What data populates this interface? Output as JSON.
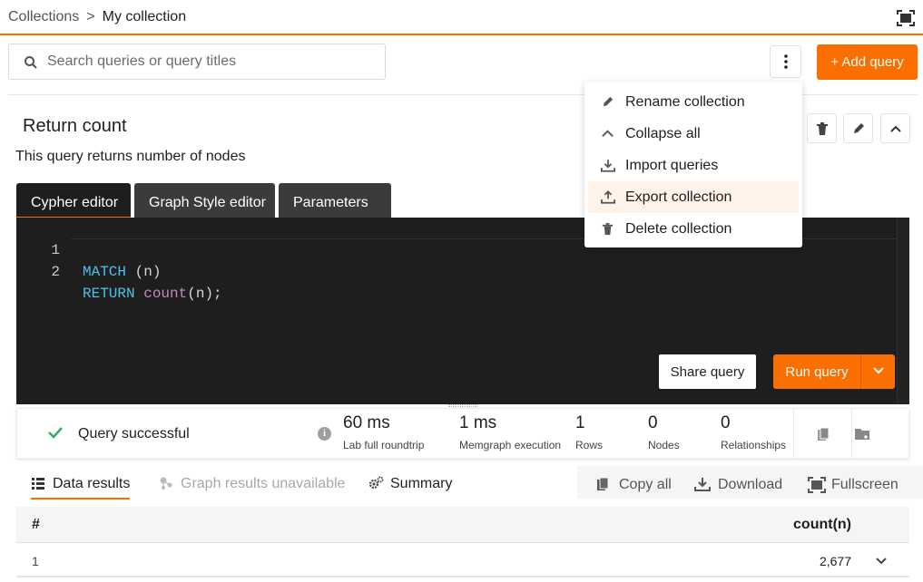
{
  "breadcrumb": {
    "root": "Collections",
    "separator": ">",
    "current": "My collection"
  },
  "search": {
    "placeholder": "Search queries or query titles"
  },
  "toolbar": {
    "add_query_label": "+ Add query"
  },
  "collection_menu": {
    "items": [
      {
        "label": "Rename collection",
        "icon": "pencil-icon"
      },
      {
        "label": "Collapse all",
        "icon": "chevron-up-icon"
      },
      {
        "label": "Import queries",
        "icon": "import-icon"
      },
      {
        "label": "Export collection",
        "icon": "export-icon",
        "highlighted": true
      },
      {
        "label": "Delete collection",
        "icon": "trash-icon"
      }
    ]
  },
  "query": {
    "title": "Return count",
    "description": "This query returns number of nodes",
    "tabs": [
      {
        "label": "Cypher editor",
        "active": true
      },
      {
        "label": "Graph Style editor",
        "active": false
      },
      {
        "label": "Parameters",
        "active": false
      }
    ],
    "code": {
      "lines": [
        {
          "number": "1",
          "kw": "MATCH",
          "rest": " (n)"
        },
        {
          "number": "2",
          "kw": "RETURN",
          "fn": "count",
          "rest": "(n);"
        }
      ]
    },
    "share_label": "Share query",
    "run_label": "Run query"
  },
  "status": {
    "message": "Query successful",
    "metrics": [
      {
        "value": "60 ms",
        "label": "Lab full roundtrip"
      },
      {
        "value": "1 ms",
        "label": "Memgraph execution"
      },
      {
        "value": "1",
        "label": "Rows"
      },
      {
        "value": "0",
        "label": "Nodes"
      },
      {
        "value": "0",
        "label": "Relationships"
      }
    ]
  },
  "results": {
    "tabs": [
      {
        "label": "Data results",
        "active": true
      },
      {
        "label": "Graph results unavailable",
        "disabled": true
      },
      {
        "label": "Summary"
      }
    ],
    "tools": {
      "copy_all": "Copy all",
      "download": "Download",
      "fullscreen": "Fullscreen"
    },
    "columns": [
      "#",
      "count(n)"
    ],
    "rows": [
      [
        "1",
        "2,677"
      ]
    ]
  },
  "colors": {
    "accent": "#fb6e00",
    "editor_bg": "#1e1e1e",
    "success": "#2eae63"
  }
}
